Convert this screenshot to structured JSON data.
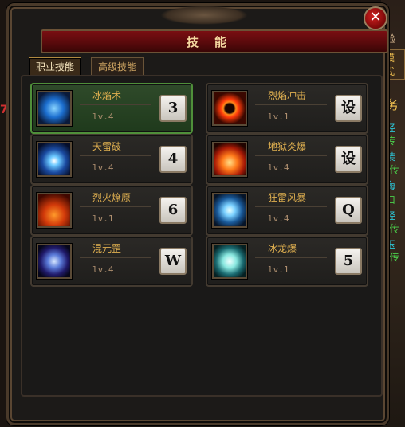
{
  "window": {
    "title": "技能",
    "close_label": "✕"
  },
  "tabs": [
    {
      "label": "职业技能",
      "active": true
    },
    {
      "label": "高级技能",
      "active": false
    }
  ],
  "skills": [
    {
      "name": "冰焰术",
      "level": "lv.4",
      "key": "3",
      "icon": "ice-flame-icon",
      "selected": true
    },
    {
      "name": "烈焰冲击",
      "level": "lv.1",
      "key": "设",
      "icon": "flame-impact-icon",
      "selected": false
    },
    {
      "name": "天雷破",
      "level": "lv.4",
      "key": "4",
      "icon": "thunder-icon",
      "selected": false
    },
    {
      "name": "地狱炎爆",
      "level": "lv.4",
      "key": "设",
      "icon": "hell-blast-icon",
      "selected": false
    },
    {
      "name": "烈火燎原",
      "level": "lv.1",
      "key": "6",
      "icon": "prairie-fire-icon",
      "selected": false
    },
    {
      "name": "狂雷风暴",
      "level": "lv.4",
      "key": "Q",
      "icon": "thunder-storm-icon",
      "selected": false
    },
    {
      "name": "混元罡",
      "level": "lv.4",
      "key": "W",
      "icon": "chaos-orb-icon",
      "selected": false
    },
    {
      "name": "冰龙爆",
      "level": "lv.1",
      "key": "5",
      "icon": "ice-dragon-icon",
      "selected": false
    }
  ],
  "background_side": {
    "texts": [
      "验",
      "模式",
      "务",
      "经",
      "传",
      "装",
      "[传",
      "海",
      "口",
      "经",
      "[传",
      "玉",
      "[传"
    ],
    "left_mark": "7"
  },
  "colors": {
    "title_bar": "#7a0e12",
    "selected_slot": "#2f4a2a",
    "skill_name": "#e0b050"
  }
}
